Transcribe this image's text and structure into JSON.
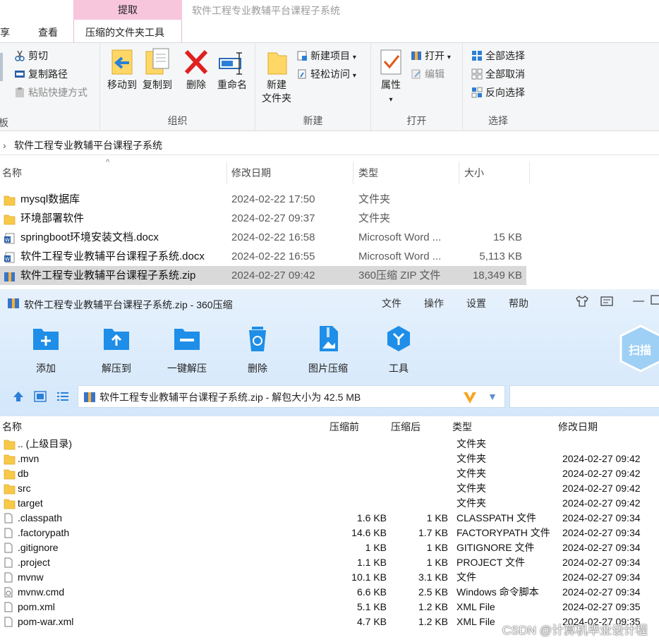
{
  "explorer": {
    "ctx_tab": "提取",
    "window_title": "软件工程专业教辅平台课程子系统",
    "tabs": [
      "享",
      "查看",
      "压缩的文件夹工具"
    ],
    "ribbon": {
      "clipboard": {
        "label": "板",
        "cut": "剪切",
        "copy_path": "复制路径",
        "paste_shortcut": "粘贴快捷方式"
      },
      "organize": {
        "label": "组织",
        "move_to": "移动到",
        "copy_to": "复制到",
        "delete": "删除",
        "rename": "重命名"
      },
      "new": {
        "label": "新建",
        "new_folder_1": "新建",
        "new_folder_2": "文件夹",
        "new_item": "新建项目",
        "easy_access": "轻松访问"
      },
      "open": {
        "label": "打开",
        "properties": "属性",
        "open": "打开",
        "edit": "编辑"
      },
      "select": {
        "label": "选择",
        "select_all": "全部选择",
        "select_none": "全部取消",
        "invert": "反向选择"
      }
    },
    "address": {
      "chevron": "›",
      "path": "软件工程专业教辅平台课程子系统"
    },
    "columns": {
      "name": "名称",
      "date": "修改日期",
      "type": "类型",
      "size": "大小",
      "sort_arrow": "^"
    },
    "files": [
      {
        "name": "mysql数据库",
        "date": "2024-02-22 17:50",
        "type": "文件夹",
        "size": "",
        "icon": "folder-icon"
      },
      {
        "name": "环境部署软件",
        "date": "2024-02-27 09:37",
        "type": "文件夹",
        "size": "",
        "icon": "folder-icon"
      },
      {
        "name": "springboot环境安装文档.docx",
        "date": "2024-02-22 16:58",
        "type": "Microsoft Word ...",
        "size": "15 KB",
        "icon": "word-doc-icon"
      },
      {
        "name": "软件工程专业教辅平台课程子系统.docx",
        "date": "2024-02-22 16:55",
        "type": "Microsoft Word ...",
        "size": "5,113 KB",
        "icon": "word-doc-icon"
      },
      {
        "name": "软件工程专业教辅平台课程子系统.zip",
        "date": "2024-02-27 09:42",
        "type": "360压缩 ZIP 文件",
        "size": "18,349 KB",
        "icon": "zip-archive-icon"
      }
    ]
  },
  "z360": {
    "title": "软件工程专业教辅平台课程子系统.zip - 360压缩",
    "menu": [
      "文件",
      "操作",
      "设置",
      "帮助"
    ],
    "win_buttons": {
      "minimize": "—"
    },
    "toolbar": [
      "添加",
      "解压到",
      "一键解压",
      "删除",
      "图片压缩",
      "工具"
    ],
    "scan": "扫描",
    "path": "软件工程专业教辅平台课程子系统.zip - 解包大小为 42.5 MB",
    "columns": {
      "name": "名称",
      "compressed_before": "压缩前",
      "compressed_after": "压缩后",
      "type": "类型",
      "date": "修改日期"
    },
    "rows": [
      {
        "name": ".. (上级目录)",
        "before": "",
        "after": "",
        "type": "文件夹",
        "date": "",
        "icon": "folder-icon"
      },
      {
        "name": ".mvn",
        "before": "",
        "after": "",
        "type": "文件夹",
        "date": "2024-02-27 09:42",
        "icon": "folder-icon"
      },
      {
        "name": "db",
        "before": "",
        "after": "",
        "type": "文件夹",
        "date": "2024-02-27 09:42",
        "icon": "folder-icon"
      },
      {
        "name": "src",
        "before": "",
        "after": "",
        "type": "文件夹",
        "date": "2024-02-27 09:42",
        "icon": "folder-icon"
      },
      {
        "name": "target",
        "before": "",
        "after": "",
        "type": "文件夹",
        "date": "2024-02-27 09:42",
        "icon": "folder-icon"
      },
      {
        "name": ".classpath",
        "before": "1.6 KB",
        "after": "1 KB",
        "type": "CLASSPATH 文件",
        "date": "2024-02-27 09:34",
        "icon": "file-icon"
      },
      {
        "name": ".factorypath",
        "before": "14.6 KB",
        "after": "1.7 KB",
        "type": "FACTORYPATH 文件",
        "date": "2024-02-27 09:34",
        "icon": "file-icon"
      },
      {
        "name": ".gitignore",
        "before": "1 KB",
        "after": "1 KB",
        "type": "GITIGNORE 文件",
        "date": "2024-02-27 09:34",
        "icon": "file-icon"
      },
      {
        "name": ".project",
        "before": "1.1 KB",
        "after": "1 KB",
        "type": "PROJECT 文件",
        "date": "2024-02-27 09:34",
        "icon": "file-icon"
      },
      {
        "name": "mvnw",
        "before": "10.1 KB",
        "after": "3.1 KB",
        "type": "文件",
        "date": "2024-02-27 09:34",
        "icon": "file-icon"
      },
      {
        "name": "mvnw.cmd",
        "before": "6.6 KB",
        "after": "2.5 KB",
        "type": "Windows 命令脚本",
        "date": "2024-02-27 09:34",
        "icon": "cmd-script-icon"
      },
      {
        "name": "pom.xml",
        "before": "5.1 KB",
        "after": "1.2 KB",
        "type": "XML File",
        "date": "2024-02-27 09:35",
        "icon": "file-icon"
      },
      {
        "name": "pom-war.xml",
        "before": "4.7 KB",
        "after": "1.2 KB",
        "type": "XML File",
        "date": "2024-02-27 09:35",
        "icon": "file-icon"
      }
    ]
  },
  "watermark": "CSDN @计算机毕业设计程"
}
